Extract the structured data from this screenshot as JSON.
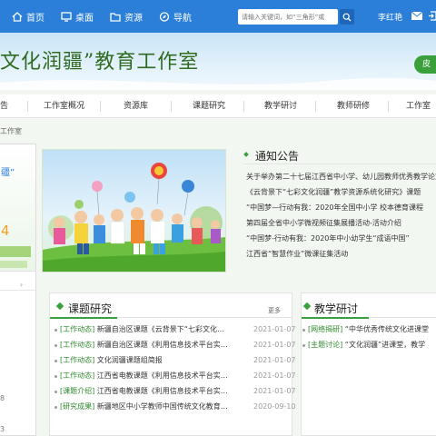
{
  "topnav": {
    "items": [
      {
        "label": "首页",
        "icon": "home-icon"
      },
      {
        "label": "桌面",
        "icon": "desktop-icon"
      },
      {
        "label": "资源",
        "icon": "folder-icon"
      },
      {
        "label": "导航",
        "icon": "compass-icon"
      }
    ]
  },
  "search": {
    "placeholder": "请输入关键词，如“三角形”或"
  },
  "user": {
    "name": "李红艳"
  },
  "banner": {
    "title": "文化润疆”教育工作室",
    "button_label": "皮"
  },
  "mainnav": {
    "items": [
      "告",
      "工作室概况",
      "资源库",
      "课题研究",
      "教学研讨",
      "教师研修",
      "工作室"
    ]
  },
  "breadcrumb": "工作室",
  "left_card": {
    "quote": "疆”",
    "number": "4",
    "chevron": "›",
    "num_a": "8",
    "num_b": "3"
  },
  "notice": {
    "title": "通知公告",
    "items": [
      "关于举办第二十七届江西省中小学、幼儿园教师优秀教学论文",
      "《云背景下“七彩文化润疆”教学资源系统化研究》课题",
      "“中国梦—行动有我：2020年全国中小学 校本德育课程",
      "第四届全省中小学微视频征集展播活动-活动介绍",
      "“中国梦-行动有我：2020年中小幼学生“成语中国”",
      "江西省“智慧作业”微课征集活动"
    ]
  },
  "research": {
    "title": "课题研究",
    "more": "更多",
    "rows": [
      {
        "tag": "[工作动态]",
        "title": "新疆自治区课题《云背景下“七彩文化…",
        "date": "2021-01-07"
      },
      {
        "tag": "[工作动态]",
        "title": "新疆自治区课题《利用信息技术平台实…",
        "date": "2021-01-07"
      },
      {
        "tag": "[工作动态]",
        "title": "文化润疆课题组简报",
        "date": "2021-01-07"
      },
      {
        "tag": "[工作动态]",
        "title": "江西省电教课题《利用信息技术平台实…",
        "date": "2021-01-07"
      },
      {
        "tag": "[课题介绍]",
        "title": "江西省电教课题《利用信息技术平台实…",
        "date": "2021-01-07"
      },
      {
        "tag": "[研究成果]",
        "title": "新疆地区中小学教师中国传统文化教育…",
        "date": "2020-09-10"
      }
    ]
  },
  "teaching": {
    "title": "教学研讨",
    "rows": [
      {
        "tag": "[网络揭研]",
        "title": "“中华优秀传统文化进课堂"
      },
      {
        "tag": "[主题讨论]",
        "title": "“文化润疆”进课堂，教学"
      }
    ]
  }
}
